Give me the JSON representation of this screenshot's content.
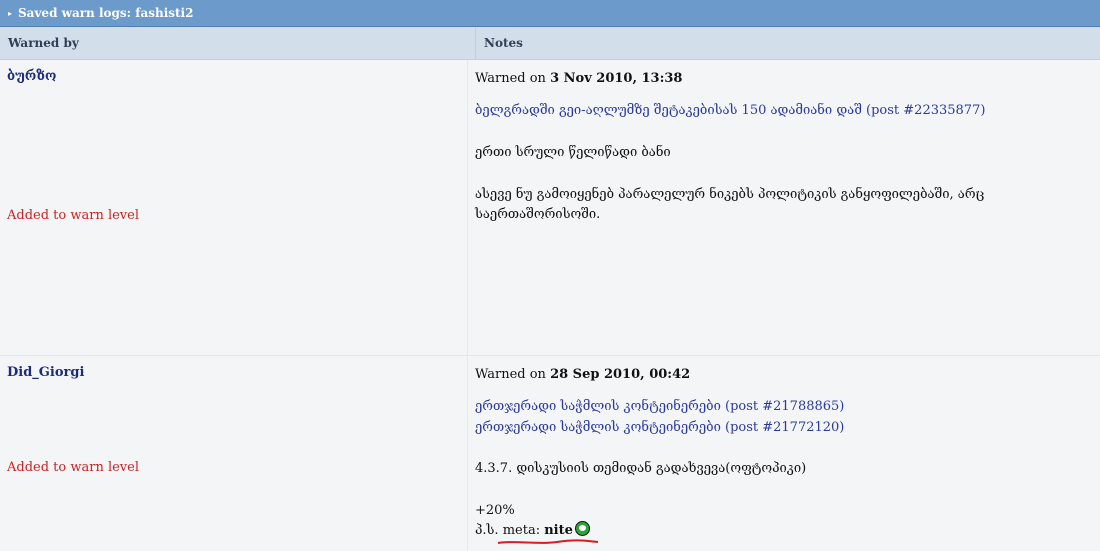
{
  "title": "Saved warn logs: fashisti2",
  "columns": {
    "warned_by": "Warned by",
    "notes": "Notes"
  },
  "entries": [
    {
      "user": "ბურზო",
      "warned_prefix": "Warned on ",
      "date": "3 Nov 2010, 13:38",
      "post_link": "ბელგრადში გეი-აღლუმზე შეტაკებისას 150 ადამიანი დაშ (post #22335877)",
      "note1": "ერთი სრული წელიწადი ბანი",
      "note2": "ასევე ნუ გამოიყენებ პარალელურ ნიკებს პოლიტიკის განყოფილებაში, არც საერთაშორისოში.",
      "added_label": "Added to warn level"
    },
    {
      "user": "Did_Giorgi",
      "warned_prefix": "Warned on ",
      "date": "28 Sep 2010, 00:42",
      "post_link1": "ერთჯერადი საჭმლის კონტეინერები (post #21788865)",
      "post_link2": "ერთჯერადი საჭმლის კონტეინერები (post #21772120)",
      "note1": "4.3.7. დისკუსიის თემიდან გადახვევა(ოფტოპიკი)",
      "percent": "+20%",
      "ps_prefix": "პ.ს. meta: ",
      "ps_bold": "nite",
      "added_label": "Added to warn level"
    }
  ],
  "colors": {
    "titlebar": "#6c9acb",
    "header": "#d3deeb",
    "user": "#1d2c7a",
    "added": "#cc2222",
    "link": "#2a3a9a"
  }
}
